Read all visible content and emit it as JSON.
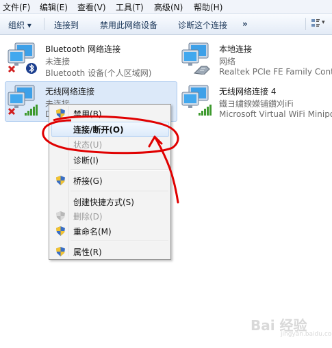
{
  "menubar": {
    "file": "文件(F)",
    "edit": "编辑(E)",
    "view": "查看(V)",
    "tools": "工具(T)",
    "advanced": "高级(N)",
    "help": "帮助(H)"
  },
  "toolbar": {
    "organize": "组织 ▾",
    "connect_to": "连接到",
    "disable_device": "禁用此网络设备",
    "diagnose": "诊断这个连接",
    "more": "»"
  },
  "adapters": [
    {
      "name": "Bluetooth 网络连接",
      "status": "未连接",
      "device": "Bluetooth 设备(个人区域网)",
      "icon": "bluetooth-adapter-icon"
    },
    {
      "name": "本地连接",
      "status": "网络",
      "device": "Realtek PCIe FE Family Contr",
      "icon": "ethernet-adapter-icon"
    },
    {
      "name": "无线网络连接",
      "status": "未连接",
      "device": "D",
      "icon": "wireless-adapter-icon"
    },
    {
      "name": "无线网络连接 4",
      "status": "鐵ヨ繍鍨嬫铺鑽刈iFi",
      "device": "Microsoft Virtual WiFi Minipo",
      "icon": "virtual-wifi-adapter-icon"
    }
  ],
  "context_menu": {
    "items": [
      {
        "label": "禁用(B)",
        "shield": true,
        "disabled": false
      },
      {
        "label": "连接/断开(O)",
        "shield": false,
        "disabled": false,
        "default": true
      },
      {
        "label": "状态(U)",
        "shield": false,
        "disabled": true
      },
      {
        "label": "诊断(I)",
        "shield": false,
        "disabled": false
      },
      {
        "label": "桥接(G)",
        "shield": true,
        "disabled": false
      },
      {
        "label": "创建快捷方式(S)",
        "shield": false,
        "disabled": false
      },
      {
        "label": "删除(D)",
        "shield": true,
        "disabled": true
      },
      {
        "label": "重命名(M)",
        "shield": true,
        "disabled": false
      },
      {
        "label": "属性(R)",
        "shield": true,
        "disabled": false
      }
    ]
  },
  "watermark": {
    "brand": "Bai 经验",
    "url": "jingyan.baidu.com"
  },
  "colors": {
    "selection": "#dce9f9",
    "annotation_red": "#e00000",
    "menu_bg": "#f3f3f3"
  }
}
